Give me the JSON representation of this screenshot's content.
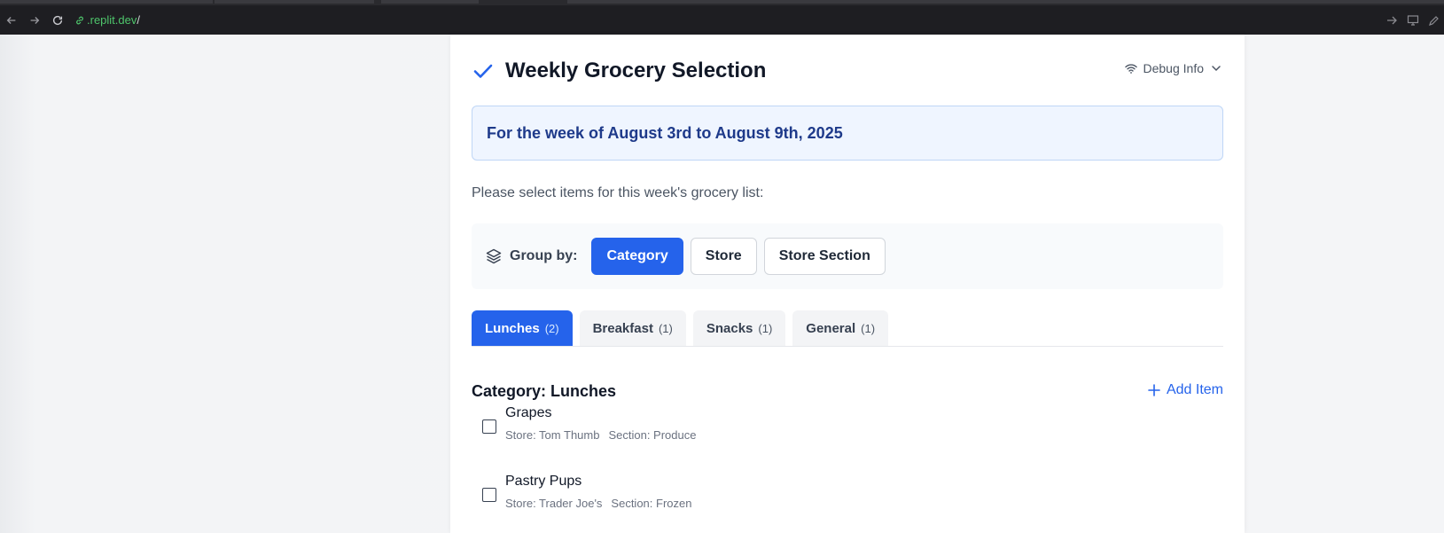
{
  "browser": {
    "url_host": ".replit.dev",
    "url_path": "/"
  },
  "header": {
    "title": "Weekly Grocery Selection",
    "debug_label": "Debug Info"
  },
  "banner": {
    "text": "For the week of August 3rd to August 9th, 2025"
  },
  "instructions": "Please select items for this week's grocery list:",
  "group_by": {
    "label": "Group by:",
    "options": [
      "Category",
      "Store",
      "Store Section"
    ],
    "selected": "Category"
  },
  "tabs": [
    {
      "label": "Lunches",
      "count": "(2)",
      "active": true
    },
    {
      "label": "Breakfast",
      "count": "(1)",
      "active": false
    },
    {
      "label": "Snacks",
      "count": "(1)",
      "active": false
    },
    {
      "label": "General",
      "count": "(1)",
      "active": false
    }
  ],
  "category": {
    "title": "Category: Lunches",
    "add_label": "Add Item"
  },
  "items": [
    {
      "name": "Grapes",
      "store": "Store: Tom Thumb",
      "section": "Section: Produce",
      "checked": false
    },
    {
      "name": "Pastry Pups",
      "store": "Store: Trader Joe's",
      "section": "Section: Frozen",
      "checked": false
    }
  ],
  "colors": {
    "accent": "#2563eb",
    "banner_bg": "#eff5ff",
    "banner_text": "#1e3a8a",
    "url_host": "#4ec46b"
  },
  "icons": [
    "back-icon",
    "forward-icon",
    "reload-icon",
    "link-icon",
    "check-icon",
    "wifi-icon",
    "chevron-down-icon",
    "layers-icon",
    "plus-icon"
  ]
}
